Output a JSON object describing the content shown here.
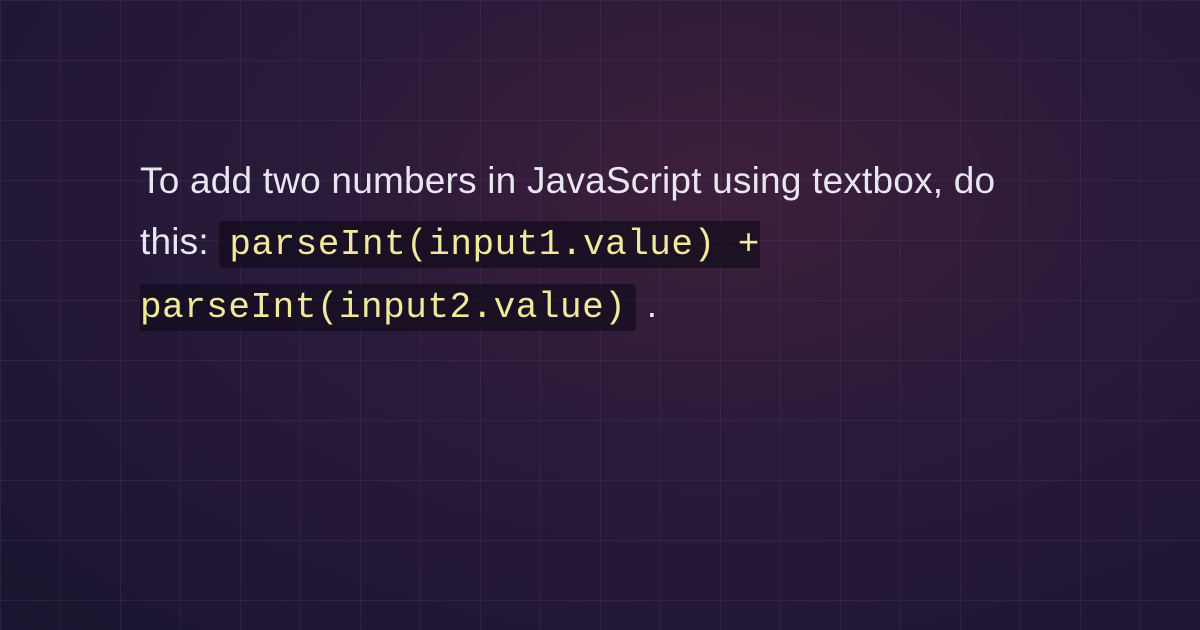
{
  "content": {
    "intro_text": "To add two numbers in JavaScript using textbox, do this: ",
    "code_snippet": "parseInt(input1.value) + parseInt(input2.value)",
    "closing_punct": "."
  }
}
